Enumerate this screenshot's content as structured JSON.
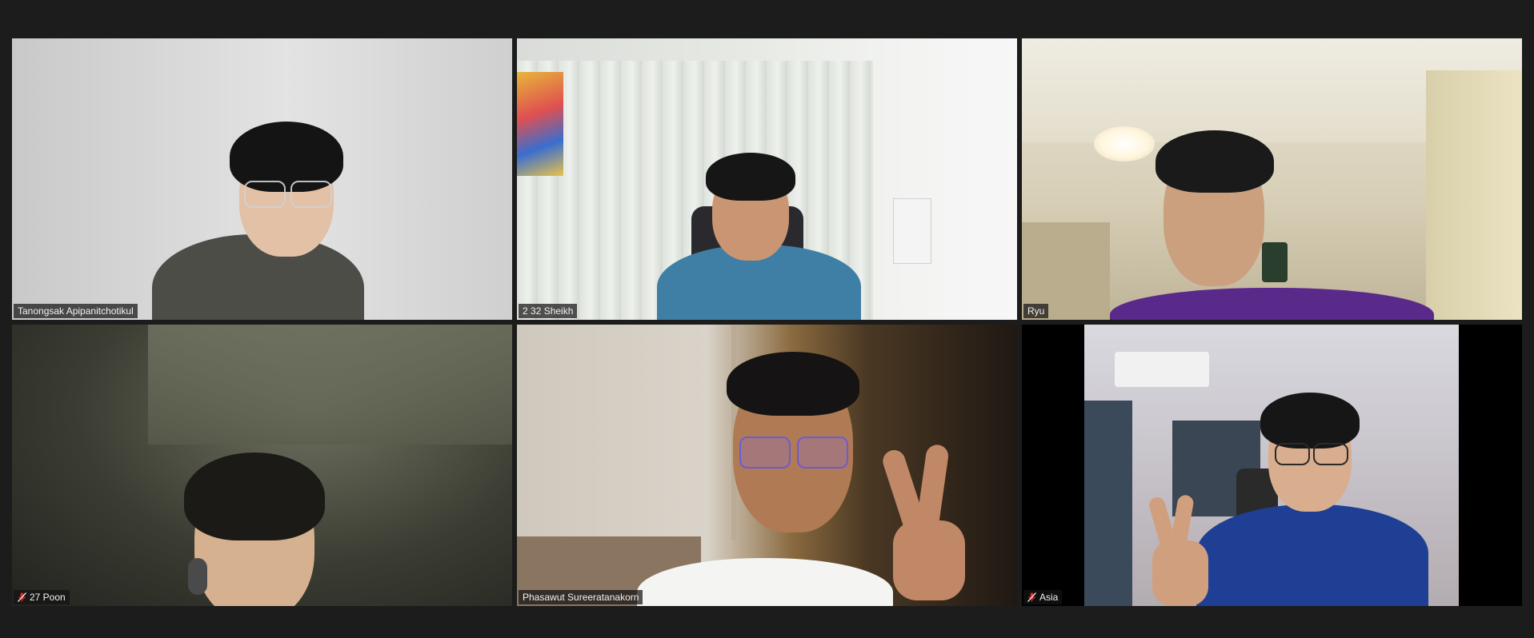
{
  "participants": [
    {
      "name": "Tanongsak Apipanitchotikul",
      "muted": false
    },
    {
      "name": "2 32 Sheikh",
      "muted": false
    },
    {
      "name": "Ryu",
      "muted": false
    },
    {
      "name": "27 Poon",
      "muted": true
    },
    {
      "name": "Phasawut Sureeratanakorn",
      "muted": false
    },
    {
      "name": "Asia",
      "muted": true
    }
  ],
  "icons": {
    "muted_mic": "mic-off-icon"
  },
  "colors": {
    "background": "#1c1c1c",
    "mute_red": "#e02828",
    "label_text": "#f2f2f2"
  }
}
